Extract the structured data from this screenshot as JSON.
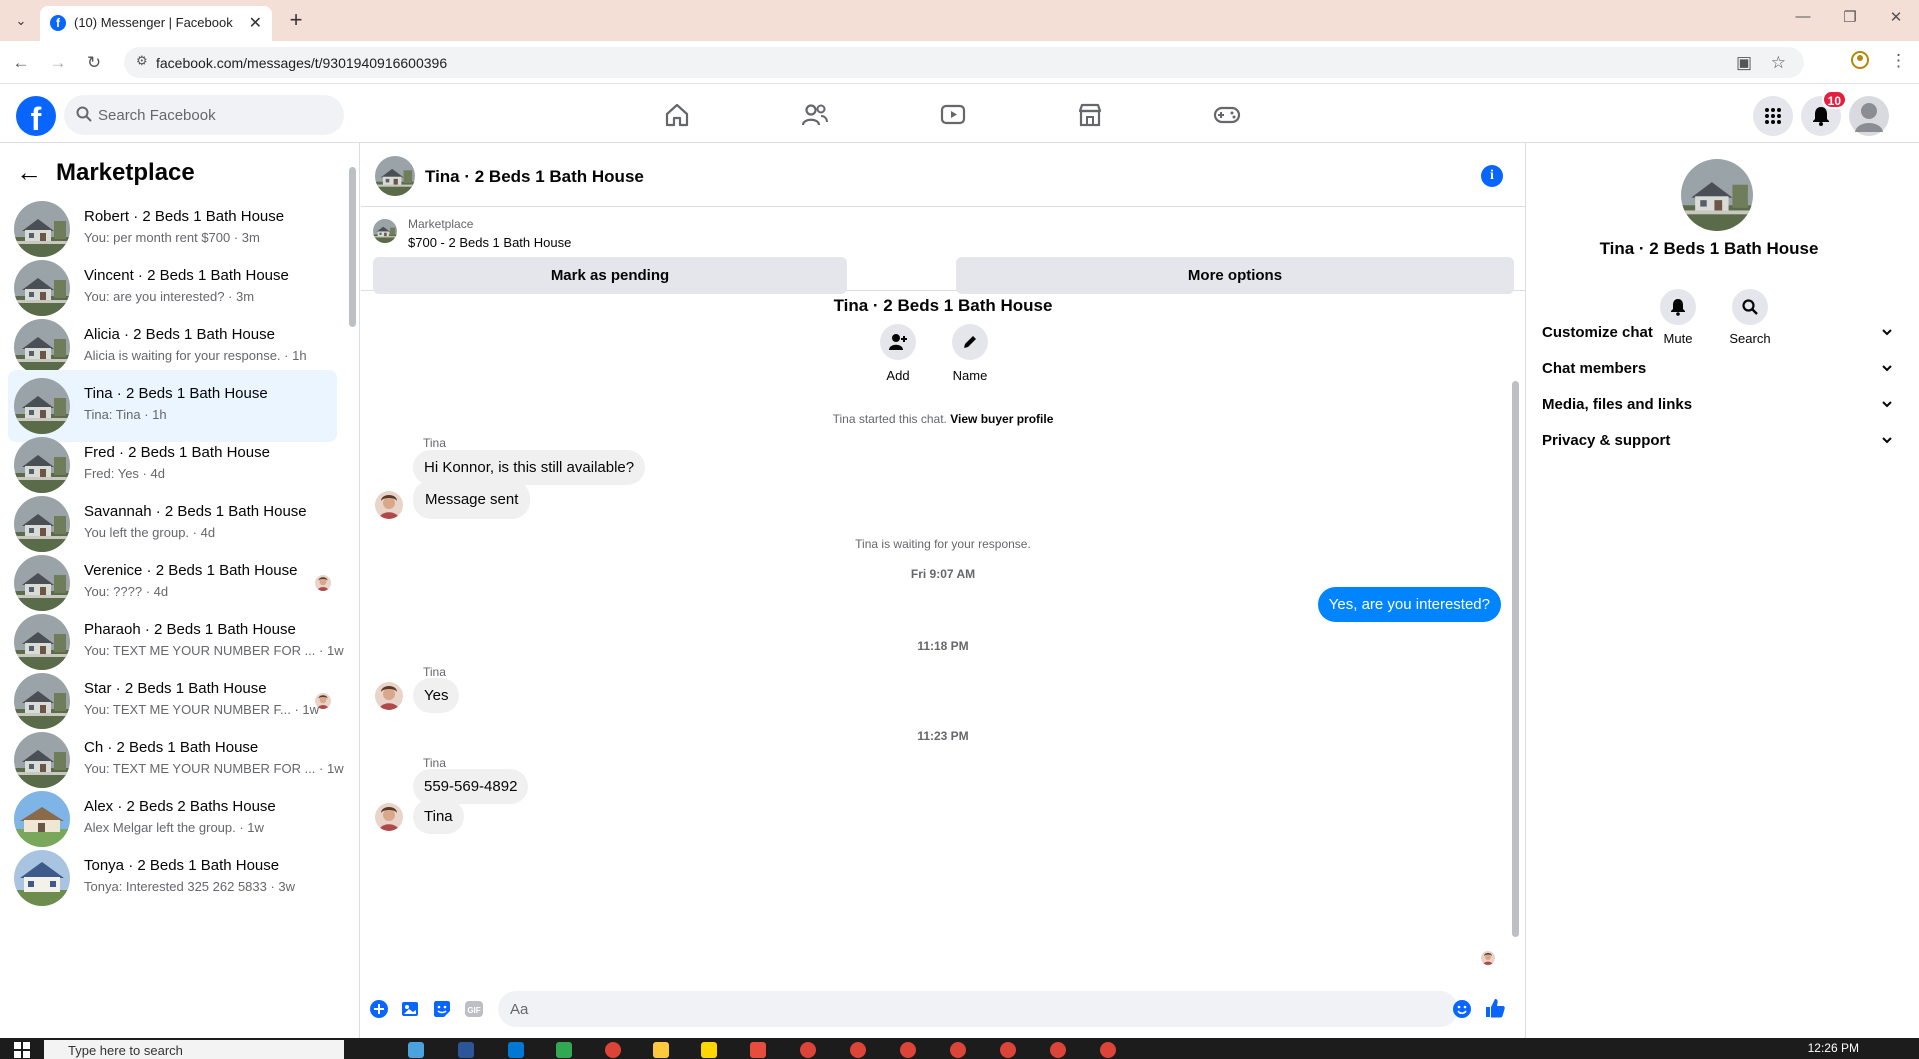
{
  "browser": {
    "tab_title": "(10) Messenger | Facebook",
    "url": "facebook.com/messages/t/9301940916600396",
    "favicon": "f",
    "menu_icons": [
      "tab-search-icon",
      "new-tab-icon",
      "minimize-icon",
      "restore-icon",
      "close-icon"
    ]
  },
  "fb": {
    "logo": "f",
    "search_placeholder": "Search Facebook",
    "notification_count": "10",
    "brand_color": "#0866ff"
  },
  "sidebar": {
    "title": "Marketplace",
    "conversations": [
      {
        "name": "Robert · 2 Beds 1 Bath House",
        "preview": "You: per month rent $700 · 3m"
      },
      {
        "name": "Vincent · 2 Beds 1 Bath House",
        "preview": "You: are you interested? · 3m"
      },
      {
        "name": "Alicia · 2 Beds 1 Bath House",
        "preview": "Alicia is waiting for your response. · 1h"
      },
      {
        "name": "Tina · 2 Beds 1 Bath House",
        "preview": "Tina: Tina · 1h"
      },
      {
        "name": "Fred · 2 Beds 1 Bath House",
        "preview": "Fred: Yes · 4d"
      },
      {
        "name": "Savannah · 2 Beds 1 Bath House",
        "preview": "You left the group. · 4d"
      },
      {
        "name": "Verenice · 2 Beds 1 Bath House",
        "preview": "You: ???? · 4d"
      },
      {
        "name": "Pharaoh · 2 Beds 1 Bath House",
        "preview": "You: TEXT ME YOUR NUMBER FOR ... · 1w"
      },
      {
        "name": "Star · 2 Beds 1 Bath House",
        "preview": "You: TEXT ME YOUR NUMBER F... · 1w"
      },
      {
        "name": "Ch · 2 Beds 1 Bath House",
        "preview": "You: TEXT ME YOUR NUMBER FOR ... · 1w"
      },
      {
        "name": "Alex · 2 Beds 2 Baths House",
        "preview": "Alex Melgar left the group. · 1w"
      },
      {
        "name": "Tonya · 2 Beds 1 Bath House",
        "preview": "Tonya: Interested 325 262 5833 · 3w"
      }
    ]
  },
  "chat": {
    "title": "Tina · 2 Beds 1 Bath House",
    "listing_kicker": "Marketplace",
    "listing_price_title": "$700 - 2 Beds 1 Bath House",
    "mark_pending_label": "Mark as pending",
    "more_options_label": "More options",
    "group_title": "Tina · 2 Beds 1 Bath House",
    "add_label": "Add",
    "name_label": "Name",
    "started_text": "Tina started this chat.",
    "view_profile_link": "View buyer profile",
    "sender_name": "Tina",
    "msg1": "Hi Konnor, is this still available?",
    "msg2": "Message sent",
    "waiting_text": "Tina is waiting for your response.",
    "time1": "Fri 9:07 AM",
    "out_msg": "Yes, are you interested?",
    "time2": "11:18 PM",
    "msg3": "Yes",
    "time3": "11:23 PM",
    "msg4": "559-569-4892",
    "msg5": "Tina",
    "composer_placeholder": "Aa",
    "out_bubble_color": "#0084ff"
  },
  "details": {
    "name": "Tina · 2 Beds 1 Bath House",
    "mute_label": "Mute",
    "search_label": "Search",
    "sections": [
      "Customize chat",
      "Chat members",
      "Media, files and links",
      "Privacy & support"
    ]
  },
  "taskbar": {
    "search_placeholder": "Type here to search",
    "clock": "12:26 PM"
  }
}
